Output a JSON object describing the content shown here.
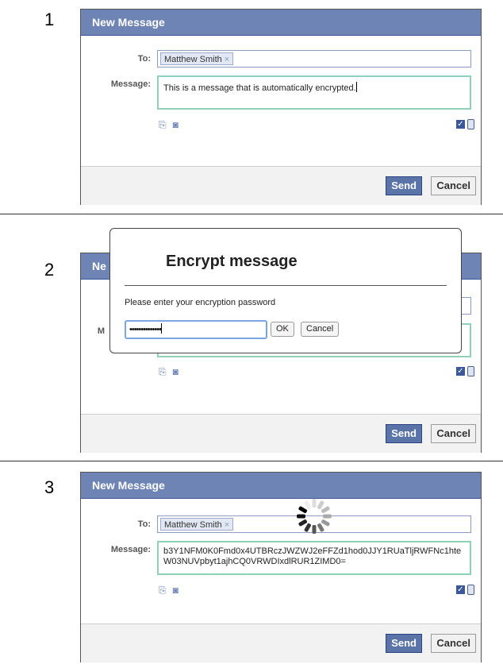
{
  "steps": [
    "1",
    "2",
    "3"
  ],
  "dialog": {
    "title": "New Message",
    "to_label": "To:",
    "message_label": "Message:",
    "recipient": "Matthew Smith",
    "remove_glyph": "×",
    "send_label": "Send",
    "cancel_label": "Cancel"
  },
  "panel1": {
    "message": "This is a message that is automatically encrypted."
  },
  "panel2": {
    "dialog_title_partial": "Ne",
    "label_partial": "M",
    "encrypt": {
      "title": "Encrypt message",
      "prompt": "Please enter your encryption password",
      "password_mask": "••••••••••••••",
      "ok_label": "OK",
      "cancel_label": "Cancel"
    }
  },
  "panel3": {
    "message": "b3Y1NFM0K0Fmd0x4UTBRczJWZWJ2eFFZd1hod0JJY1RUaTljRWFNc1hteW03NUVpbyt1ajhCQ0VRWDIxdlRUR1ZIMD0="
  },
  "colors": {
    "header": "#6d84b4",
    "send": "#5b74a8",
    "focus_green": "#8ed1b6"
  },
  "icons": [
    "attach-icon",
    "camera-icon",
    "encrypt-checkbox-icon",
    "lock-icon",
    "loading-spinner-icon"
  ]
}
